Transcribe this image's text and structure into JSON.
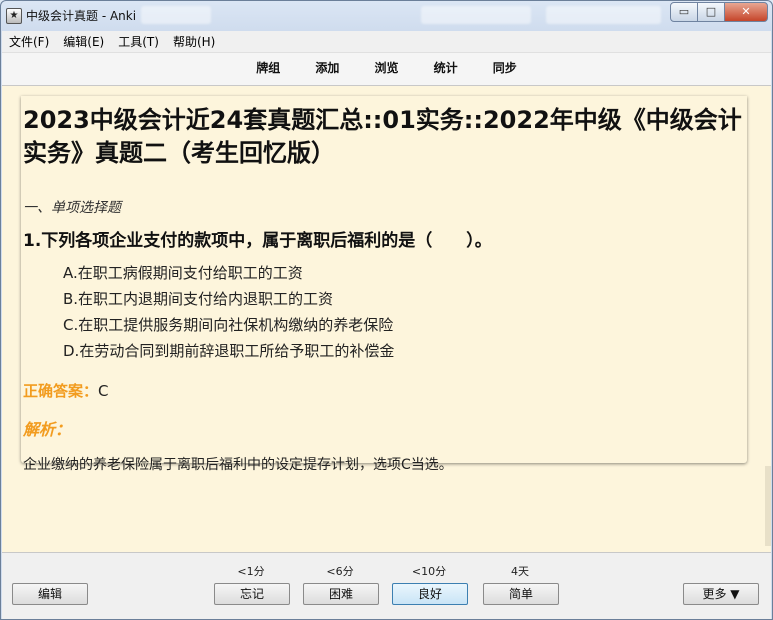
{
  "window": {
    "title": "中级会计真题 - Anki",
    "controls": {
      "minimize": "▭",
      "maximize": "□",
      "close": "✕"
    }
  },
  "menu": [
    "文件(F)",
    "编辑(E)",
    "工具(T)",
    "帮助(H)"
  ],
  "toolbar": [
    "牌组",
    "添加",
    "浏览",
    "统计",
    "同步"
  ],
  "card": {
    "deck_title": "2023中级会计近24套真题汇总::01实务::2022年中级《中级会计实务》真题二（考生回忆版）",
    "section": "一、单项选择题",
    "question": "1.下列各项企业支付的款项中，属于离职后福利的是（　　）。",
    "options": [
      "A.在职工病假期间支付给职工的工资",
      "B.在职工内退期间支付给内退职工的工资",
      "C.在职工提供服务期间向社保机构缴纳的养老保险",
      "D.在劳动合同到期前辞退职工所给予职工的补偿金"
    ],
    "answer_label": "正确答案：",
    "answer_value": "C",
    "analysis_label": "解析：",
    "explanation": "企业缴纳的养老保险属于离职后福利中的设定提存计划，选项C当选。"
  },
  "bottom": {
    "edit_label": "编辑",
    "more_label": "更多 ▼",
    "answers": [
      {
        "interval": "<1分",
        "label": "忘记"
      },
      {
        "interval": "<6分",
        "label": "困难"
      },
      {
        "interval": "<10分",
        "label": "良好"
      },
      {
        "interval": "4天",
        "label": "简单"
      }
    ]
  },
  "colors": {
    "card_bg": "#fdf5dc",
    "accent": "#f29c1f"
  }
}
